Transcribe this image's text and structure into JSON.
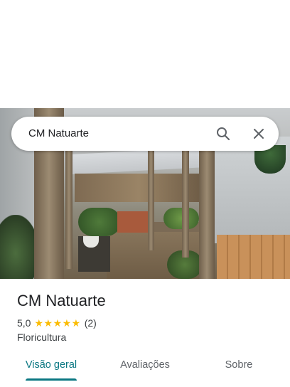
{
  "search": {
    "query": "CM Natuarte",
    "search_icon": "search-icon",
    "close_icon": "close-icon"
  },
  "hero_image": {
    "description_icon": "place-photo"
  },
  "place": {
    "name": "CM Natuarte",
    "rating": "5,0",
    "stars": "★★★★★",
    "star_rating_value": 5,
    "review_count": "(2)",
    "category": "Floricultura"
  },
  "tabs": [
    {
      "label": "Visão geral",
      "active": true
    },
    {
      "label": "Avaliações",
      "active": false
    },
    {
      "label": "Sobre",
      "active": false
    }
  ],
  "colors": {
    "accent": "#0a7782",
    "star": "#fbbc04",
    "text_primary": "#202124",
    "text_secondary": "#3c4043"
  }
}
